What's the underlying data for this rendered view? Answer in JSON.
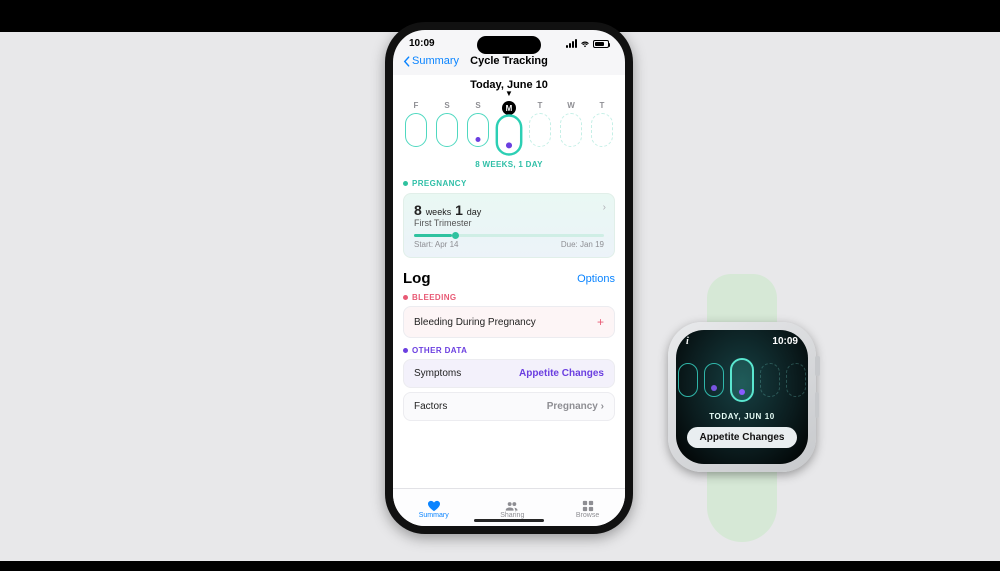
{
  "colors": {
    "accent_blue": "#0a84ff",
    "teal": "#2fc29f",
    "purple": "#6b3fe0",
    "red": "#e85a75"
  },
  "phone": {
    "status": {
      "time": "10:09"
    },
    "nav": {
      "back": "Summary",
      "title": "Cycle Tracking"
    },
    "date_header": "Today, June 10",
    "days": [
      "F",
      "S",
      "S",
      "M",
      "T",
      "W",
      "T"
    ],
    "weeks_label": "8 WEEKS, 1 DAY",
    "pregnancy": {
      "label": "PREGNANCY",
      "weeks_num": "8",
      "weeks_unit": "weeks",
      "days_num": "1",
      "days_unit": "day",
      "trimester": "First Trimester",
      "start_label": "Start: Apr 14",
      "due_label": "Due: Jan 19"
    },
    "log": {
      "title": "Log",
      "options": "Options",
      "bleeding_label": "BLEEDING",
      "bleeding_item": "Bleeding During Pregnancy",
      "other_label": "OTHER DATA",
      "symptoms_title": "Symptoms",
      "symptoms_value": "Appetite Changes",
      "factors_title": "Factors",
      "factors_value": "Pregnancy"
    },
    "tabs": {
      "summary": "Summary",
      "sharing": "Sharing",
      "browse": "Browse"
    }
  },
  "watch": {
    "info_glyph": "i",
    "time": "10:09",
    "date": "TODAY, JUN 10",
    "chip": "Appetite Changes"
  }
}
